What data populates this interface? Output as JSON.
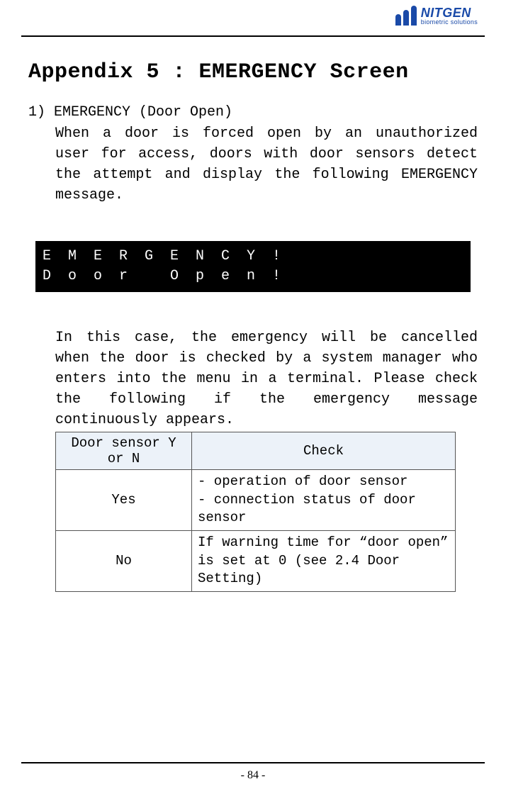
{
  "brand": {
    "name": "NITGEN",
    "subtitle": "biometric solutions"
  },
  "title": "Appendix 5 : EMERGENCY Screen",
  "section_heading": "1) EMERGENCY (Door Open)",
  "para1": "When a door is forced open by an unauthorized user for access, doors with door sensors detect the attempt and display the following EMERGENCY message.",
  "lcd": {
    "line1": "E  M  E  R  G  E  N  C  Y  !",
    "line2": "D  o  o  r     O  p  e  n  !"
  },
  "para2": "In this case, the emergency will be cancelled when the door is checked by a system manager who enters into the menu in a terminal. Please check the following if the emergency message continuously appears.",
  "table": {
    "headers": {
      "col1": "Door sensor Y or N",
      "col2": "Check"
    },
    "rows": [
      {
        "yn": "Yes",
        "check": "- operation of door sensor\n- connection status of door sensor"
      },
      {
        "yn": "No",
        "check": "If warning time for “door open” is set at 0 (see 2.4 Door Setting)"
      }
    ]
  },
  "page_number": "- 84 -"
}
